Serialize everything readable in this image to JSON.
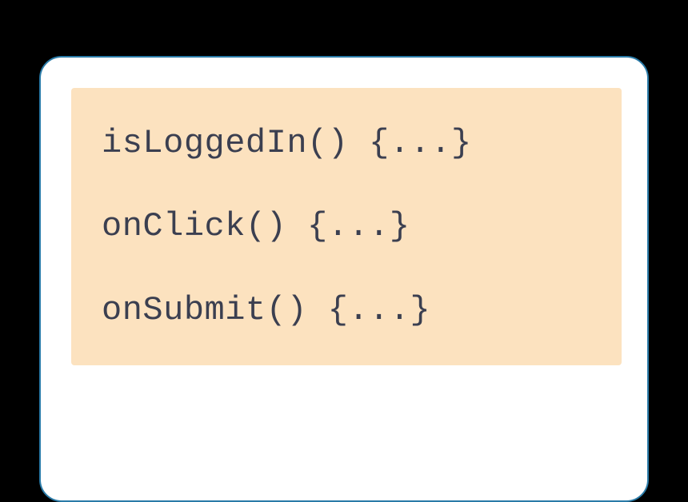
{
  "code": {
    "lines": [
      "isLoggedIn() {...}",
      "onClick() {...}",
      "onSubmit() {...}"
    ]
  },
  "colors": {
    "background": "#000000",
    "cardBackground": "#ffffff",
    "cardBorder": "#2a7ba8",
    "codeBlockBackground": "#fce2bf",
    "codeText": "#3b3f50"
  }
}
